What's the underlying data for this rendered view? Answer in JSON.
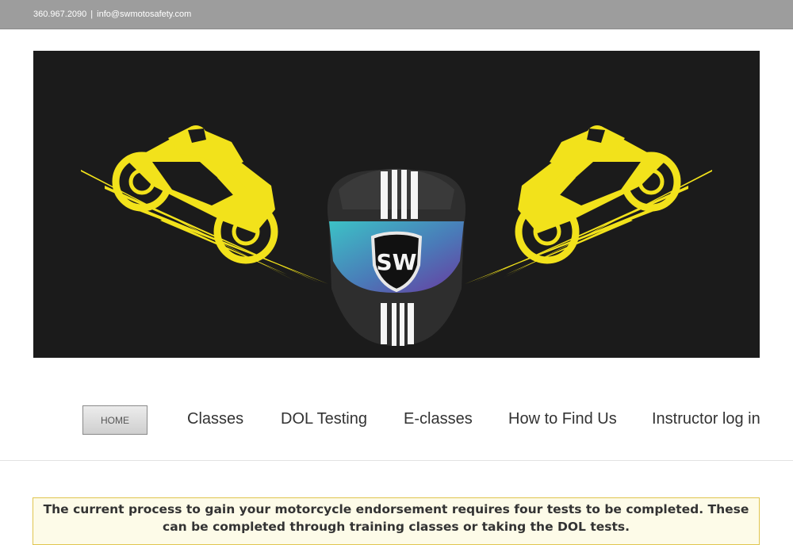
{
  "topbar": {
    "phone": "360.967.2090",
    "separator": "|",
    "email": "info@swmotosafety.com"
  },
  "banner": {
    "logo_text": "SW",
    "colors": {
      "background": "#1b1b1b",
      "rider_yellow": "#f2e21b",
      "visor_teal": "#3cc2c6",
      "visor_purple": "#6a3aa0"
    }
  },
  "nav": {
    "home": "HOME",
    "items": [
      "Classes",
      "DOL Testing",
      "E-classes",
      "How to Find Us",
      "Instructor log in"
    ]
  },
  "notice": {
    "text": "The current process to gain your motorcycle endorsement requires four tests to be completed. These can be completed through training classes or  taking the DOL tests."
  }
}
